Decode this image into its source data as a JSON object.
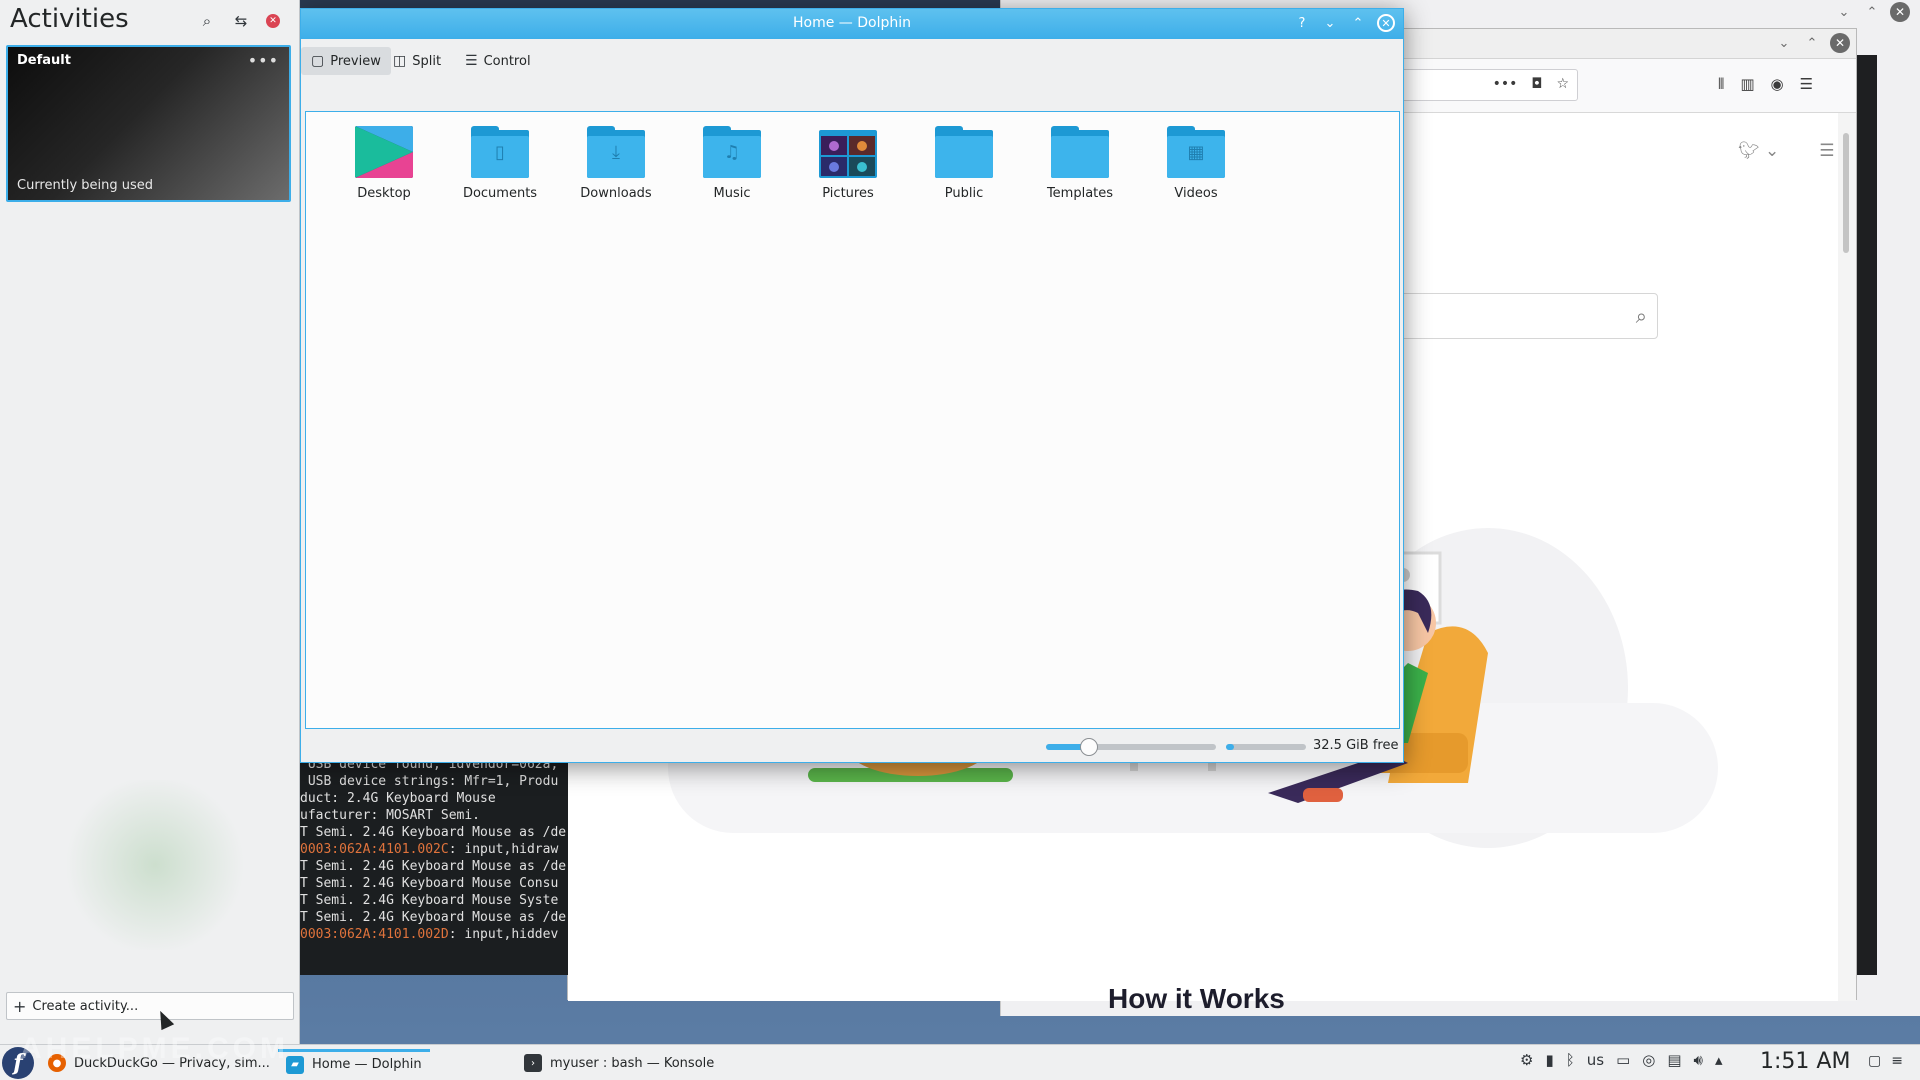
{
  "activities_panel": {
    "title": "Activities",
    "header_icons": [
      "search-icon",
      "sliders-icon",
      "close-icon"
    ],
    "activity": {
      "name": "Default",
      "status": "Currently being used",
      "more_glyph": "•••"
    },
    "create_label": "Create activity...",
    "create_glyph": "+"
  },
  "dolphin": {
    "title": "Home — Dolphin",
    "title_controls": [
      "?",
      "⌄",
      "⌃",
      "✕"
    ],
    "toolbar": {
      "preview": "Preview",
      "split": "Split",
      "control": "Control"
    },
    "files": [
      {
        "label": "Desktop",
        "icon": "desktop-folder"
      },
      {
        "label": "Documents",
        "icon": "documents-folder"
      },
      {
        "label": "Downloads",
        "icon": "downloads-folder"
      },
      {
        "label": "Music",
        "icon": "music-folder"
      },
      {
        "label": "Pictures",
        "icon": "pictures-folder"
      },
      {
        "label": "Public",
        "icon": "public-folder"
      },
      {
        "label": "Templates",
        "icon": "templates-folder"
      },
      {
        "label": "Videos",
        "icon": "videos-folder"
      }
    ],
    "status": {
      "zoom_fraction": 0.25,
      "disk_used_fraction": 0.1,
      "free_space": "32.5 GiB free"
    },
    "colors": {
      "accent": "#3daee9",
      "folder": "#3db4ec"
    }
  },
  "konsole": {
    "lines": [
      {
        "text": " USB device found, idVendor=062a,",
        "highlight": ""
      },
      {
        "text": " USB device strings: Mfr=1, Produ",
        "highlight": ""
      },
      {
        "text": "duct: 2.4G Keyboard Mouse",
        "highlight": ""
      },
      {
        "text": "ufacturer: MOSART Semi.",
        "highlight": ""
      },
      {
        "text": "T Semi. 2.4G Keyboard Mouse as /de",
        "highlight": ""
      },
      {
        "text": ": input,hidraw",
        "highlight": "0003:062A:4101.002C"
      },
      {
        "text": "T Semi. 2.4G Keyboard Mouse as /de",
        "highlight": ""
      },
      {
        "text": "T Semi. 2.4G Keyboard Mouse Consu",
        "highlight": ""
      },
      {
        "text": "T Semi. 2.4G Keyboard Mouse Syste",
        "highlight": ""
      },
      {
        "text": "T Semi. 2.4G Keyboard Mouse as /de",
        "highlight": ""
      },
      {
        "text": ": input,hiddev",
        "highlight": "0003:062A:4101.002D"
      }
    ]
  },
  "browser": {
    "page_heading": "How it Works",
    "url_actions": [
      "•••",
      "pocket-icon",
      "star-icon"
    ],
    "toolbar_icons": [
      "library-icon",
      "sidebar-icon",
      "account-icon",
      "menu-icon"
    ]
  },
  "taskbar": {
    "tasks": [
      {
        "label": "DuckDuckGo — Privacy, sim...",
        "icon": "firefox-icon"
      },
      {
        "label": "Home — Dolphin",
        "icon": "dolphin-icon"
      },
      {
        "label": "myuser : bash — Konsole",
        "icon": "konsole-icon"
      }
    ],
    "keyboard_layout": "us",
    "clock": "1:51 AM"
  },
  "watermark": "AHELPME.COM"
}
